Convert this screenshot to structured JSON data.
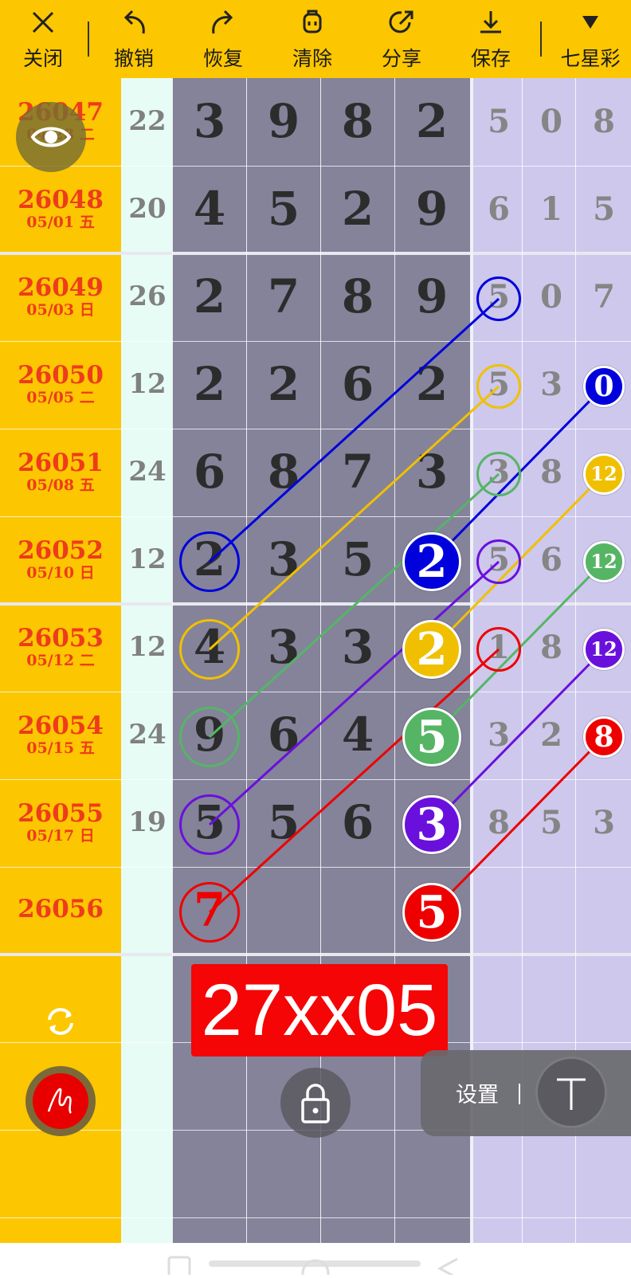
{
  "toolbar": {
    "close": "关闭",
    "undo": "撤销",
    "redo": "恢复",
    "clear": "清除",
    "share": "分享",
    "save": "保存",
    "lottery_type": "七星彩"
  },
  "rows": [
    {
      "issue": "26047",
      "date": "04/28 二",
      "sum": "22",
      "main": [
        "3",
        "9",
        "8",
        "2"
      ],
      "right": [
        "5",
        "0",
        "8"
      ]
    },
    {
      "issue": "26048",
      "date": "05/01 五",
      "sum": "20",
      "main": [
        "4",
        "5",
        "2",
        "9"
      ],
      "right": [
        "6",
        "1",
        "5"
      ]
    },
    {
      "issue": "26049",
      "date": "05/03 日",
      "sum": "26",
      "main": [
        "2",
        "7",
        "8",
        "9"
      ],
      "right": [
        "5",
        "0",
        "7"
      ]
    },
    {
      "issue": "26050",
      "date": "05/05 二",
      "sum": "12",
      "main": [
        "2",
        "2",
        "6",
        "2"
      ],
      "right": [
        "5",
        "3",
        "0"
      ]
    },
    {
      "issue": "26051",
      "date": "05/08 五",
      "sum": "24",
      "main": [
        "6",
        "8",
        "7",
        "3"
      ],
      "right": [
        "3",
        "8",
        "12"
      ]
    },
    {
      "issue": "26052",
      "date": "05/10 日",
      "sum": "12",
      "main": [
        "2",
        "3",
        "5",
        "2"
      ],
      "right": [
        "5",
        "6",
        "12"
      ]
    },
    {
      "issue": "26053",
      "date": "05/12 二",
      "sum": "12",
      "main": [
        "4",
        "3",
        "3",
        "2"
      ],
      "right": [
        "1",
        "8",
        "12"
      ]
    },
    {
      "issue": "26054",
      "date": "05/15 五",
      "sum": "24",
      "main": [
        "9",
        "6",
        "4",
        "5"
      ],
      "right": [
        "3",
        "2",
        "8"
      ]
    },
    {
      "issue": "26055",
      "date": "05/17 日",
      "sum": "19",
      "main": [
        "5",
        "5",
        "6",
        "3"
      ],
      "right": [
        "8",
        "5",
        "3"
      ]
    },
    {
      "issue": "26056",
      "date": "",
      "sum": "",
      "main": [
        "7",
        "",
        "",
        "5"
      ],
      "right": [
        "",
        "",
        ""
      ]
    }
  ],
  "result_text": "27xx05",
  "panel": {
    "settings": "设置"
  },
  "colors": {
    "toolbar_bg": "#fcc600",
    "main_grid_bg": "#84839a",
    "right_grid_bg": "#cdc8ec",
    "sum_col_bg": "#e6fcf5",
    "issue_text": "#ee3b1c",
    "blue": "#0000dd",
    "yellow": "#f0c000",
    "green": "#55b565",
    "purple": "#6a10dc",
    "red": "#ee0000",
    "result_bg": "#f50505"
  },
  "icons": [
    "close-icon",
    "undo-icon",
    "redo-icon",
    "clear-icon",
    "share-icon",
    "save-icon",
    "dropdown-triangle-icon",
    "eye-icon",
    "refresh-icon",
    "brush-icon",
    "lock-icon",
    "text-tool-icon"
  ]
}
